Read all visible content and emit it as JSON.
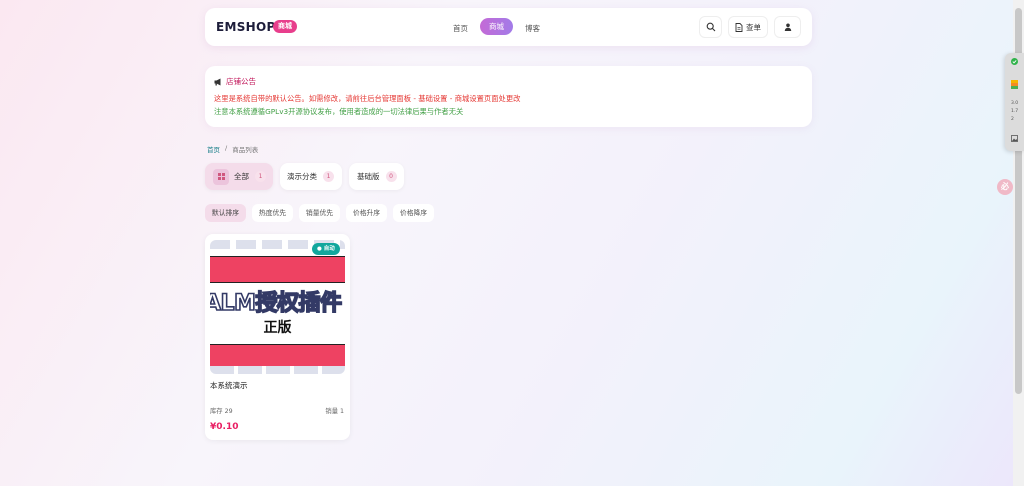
{
  "header": {
    "brand": "EMSHOP",
    "brand_badge": "商城",
    "nav": {
      "home": "首页",
      "shop": "商城",
      "blog": "博客"
    },
    "order_button": "查单"
  },
  "notice": {
    "title": "店铺公告",
    "line1": "这里是系统自带的默认公告。如需修改，请前往后台管理面板 - 基础设置 - 商城设置页面处更改",
    "line2": "注意本系统遵循GPLv3开源协议发布，使用者造成的一切法律后果与作者无关"
  },
  "breadcrumb": {
    "home": "首页",
    "separator": "/",
    "current": "商品列表"
  },
  "categories": [
    {
      "label": "全部",
      "count": "1"
    },
    {
      "label": "演示分类",
      "count": "1"
    },
    {
      "label": "基础版",
      "count": "0"
    }
  ],
  "sort": [
    "默认排序",
    "热度优先",
    "销量优先",
    "价格升序",
    "价格降序"
  ],
  "product": {
    "badge": "● 自动",
    "image_line1": "ALM授权插件",
    "image_line2": "正版",
    "name": "本系统演示",
    "stock": "库存 29",
    "sales": "销量 1",
    "price": "¥0.10"
  },
  "side_panel": {
    "value1": "3.0",
    "value2": "1.7",
    "value3": "2"
  },
  "float_button": "必",
  "colors": {
    "accent": "#e83e8c",
    "notice_red": "#e53935",
    "notice_green": "#43a047",
    "auto_badge": "#12a79d"
  }
}
